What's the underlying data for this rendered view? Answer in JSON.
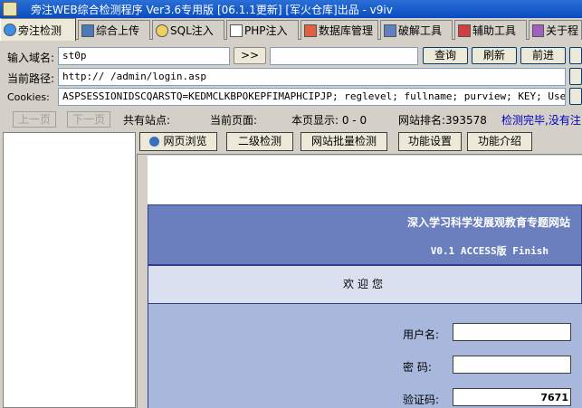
{
  "window": {
    "title": "旁注WEB综合检测程序 Ver3.6专用版 [06.1.1更新] [军火仓库]出品 -  v9iv"
  },
  "tabs": [
    {
      "label": "旁注检测",
      "icon": "globe-icon",
      "active": true
    },
    {
      "label": "综合上传",
      "icon": "chart-icon",
      "active": false
    },
    {
      "label": "SQL注入",
      "icon": "magnifier-icon",
      "active": false
    },
    {
      "label": "PHP注入",
      "icon": "document-icon",
      "active": false
    },
    {
      "label": "数据库管理",
      "icon": "database-icon",
      "active": false
    },
    {
      "label": "破解工具",
      "icon": "tools-icon",
      "active": false
    },
    {
      "label": "辅助工具",
      "icon": "helper-icon",
      "active": false
    },
    {
      "label": "关于程",
      "icon": "info-icon",
      "active": false
    }
  ],
  "form": {
    "domain_label": "输入域名:",
    "domain_value": "st0p",
    "arrow_button": ">>",
    "query_button": "查询",
    "refresh_button": "刷新",
    "forward_button": "前进",
    "path_label": "当前路径:",
    "path_value": "http://          /admin/login.asp",
    "cookies_label": "Cookies:",
    "cookies_value": "ASPSESSIONIDSCQARSTQ=KEDMCLKBPOKEPFIMAPHCIPJP; reglevel; fullname; purview; KEY; UserName"
  },
  "status": {
    "prev_page": "上一页",
    "next_page": "下一页",
    "total_sites": "共有站点:",
    "current_page": "当前页面:",
    "page_display": "本页显示:  0 - 0",
    "site_rank": "网站排名:393578",
    "check_done": "检测完毕,没有注"
  },
  "toolbar": {
    "browse": "网页浏览",
    "second_level": "二级检测",
    "batch_check": "网站批量检测",
    "settings": "功能设置",
    "intro": "功能介绍"
  },
  "web": {
    "site_title": "深入学习科学发展观教育专题网站",
    "version": "V0.1 ACCESS版 Finish",
    "welcome": "欢迎您",
    "username_label": "用户名:",
    "password_label": "密  码:",
    "captcha_label": "验证码:",
    "captcha_value": "7671"
  },
  "colors": {
    "titlebar": "#0a4cc0",
    "site_header": "#6b7fbf",
    "login_bg": "#a8b8dc",
    "status_blue": "#0000c0"
  }
}
